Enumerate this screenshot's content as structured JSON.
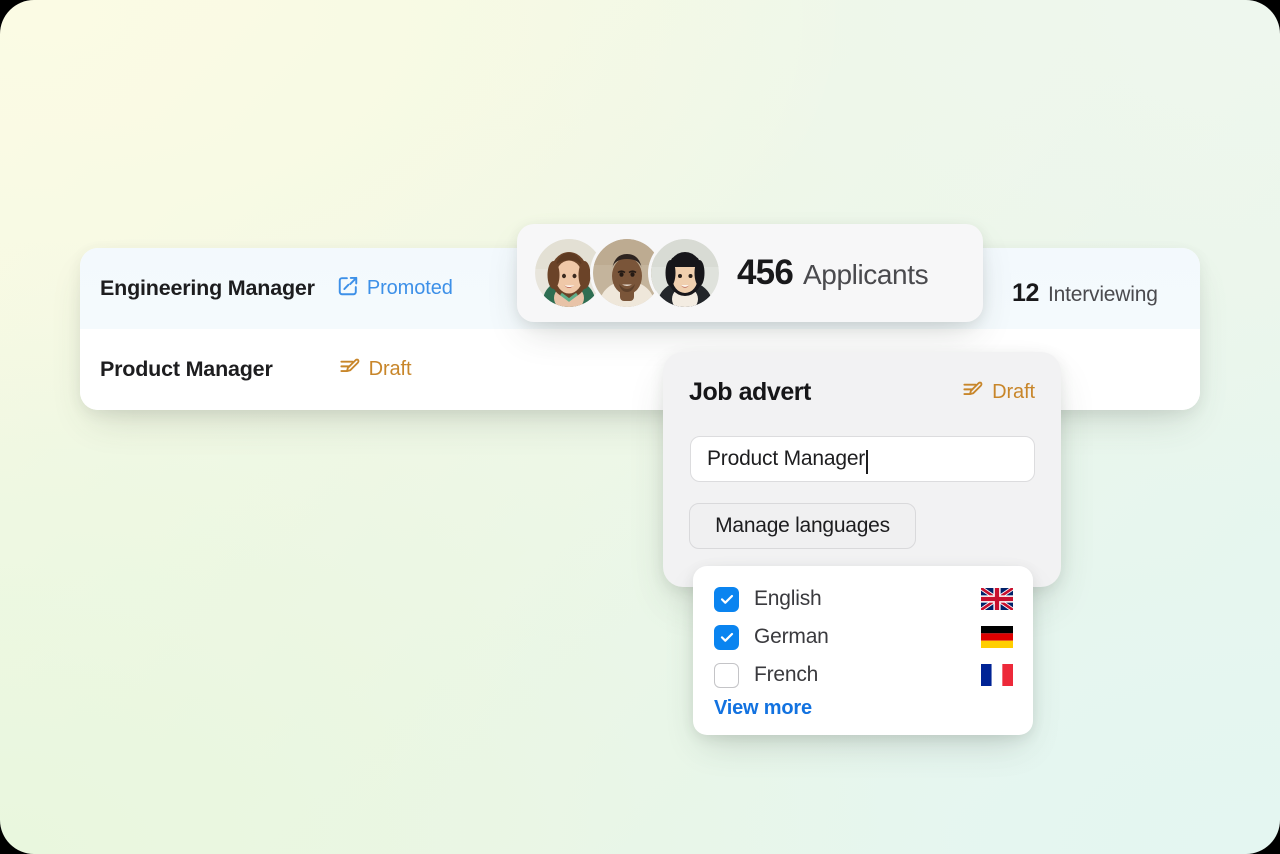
{
  "jobs": {
    "rows": [
      {
        "title": "Engineering Manager",
        "status": "Promoted",
        "status_icon": "promote-box-arrow-icon",
        "status_color": "#3d90e8"
      },
      {
        "title": "Product Manager",
        "status": "Draft",
        "status_icon": "draft-edit-lines-icon",
        "status_color": "#c8862a"
      }
    ]
  },
  "applicants": {
    "count": "456",
    "label": "Applicants",
    "avatars": [
      "avatar-person-1",
      "avatar-person-2",
      "avatar-person-3"
    ]
  },
  "interviewing": {
    "count": "12",
    "label": "Interviewing"
  },
  "advert": {
    "title": "Job advert",
    "status": "Draft",
    "status_icon": "draft-edit-lines-icon",
    "status_color": "#c8862a",
    "title_input": {
      "value": "Product Manager",
      "placeholder": "Job title"
    },
    "manage_languages_label": "Manage languages"
  },
  "languages": {
    "items": [
      {
        "name": "English",
        "checked": true,
        "flag": "flag-gb",
        "flag_emoji": "🇬🇧"
      },
      {
        "name": "German",
        "checked": true,
        "flag": "flag-de",
        "flag_emoji": "🇩🇪"
      },
      {
        "name": "French",
        "checked": false,
        "flag": "flag-fr",
        "flag_emoji": "🇫🇷"
      }
    ],
    "view_more_label": "View more"
  },
  "theme": {
    "accent_blue": "#0a84f0",
    "link_blue": "#1272e0",
    "promoted_blue": "#3d90e8",
    "draft_amber": "#c8862a",
    "card_white": "#ffffff",
    "panel_gray": "#f2f2f3",
    "row_tint_blue": "#f3f9fd"
  }
}
